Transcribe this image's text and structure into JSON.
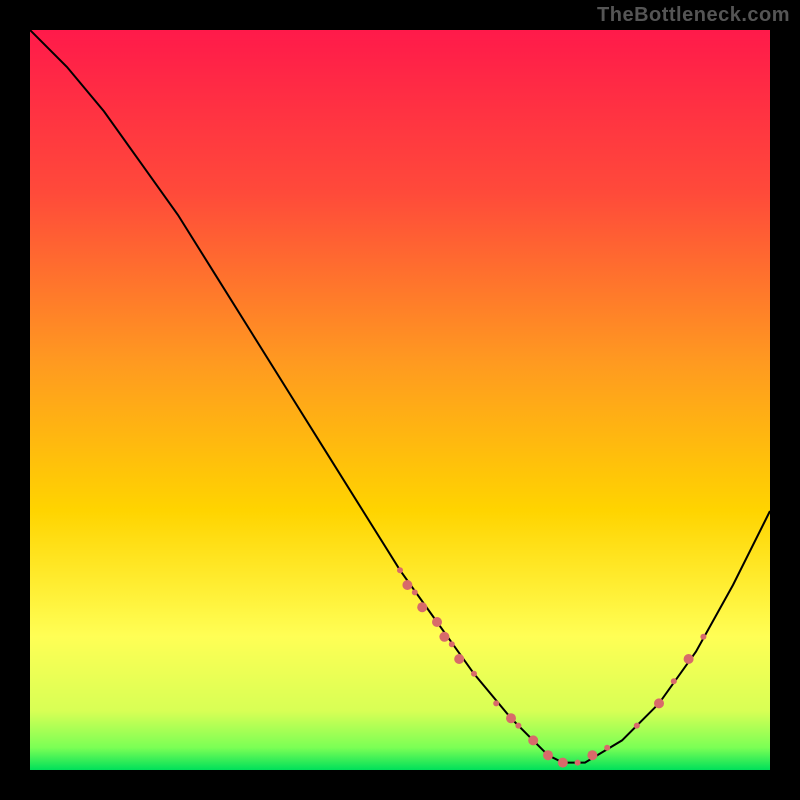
{
  "watermark": "TheBottleneck.com",
  "chart_data": {
    "type": "line",
    "title": "",
    "xlabel": "",
    "ylabel": "",
    "xlim": [
      0,
      100
    ],
    "ylim": [
      0,
      100
    ],
    "grid": false,
    "legend": false,
    "background_gradient": {
      "top": "#ff1a4a",
      "mid_upper": "#ff6a2a",
      "mid": "#ffd400",
      "mid_lower": "#ffff55",
      "bottom": "#00e05a"
    },
    "series": [
      {
        "name": "curve",
        "type": "line",
        "color": "#000000",
        "x": [
          0,
          5,
          10,
          15,
          20,
          25,
          30,
          35,
          40,
          45,
          50,
          55,
          60,
          65,
          68,
          70,
          72,
          75,
          80,
          85,
          90,
          95,
          100
        ],
        "y": [
          100,
          95,
          89,
          82,
          75,
          67,
          59,
          51,
          43,
          35,
          27,
          20,
          13,
          7,
          4,
          2,
          1,
          1,
          4,
          9,
          16,
          25,
          35
        ]
      },
      {
        "name": "dots-falling",
        "type": "scatter",
        "color": "#d86a6a",
        "radius_small": 3,
        "radius_large": 5,
        "points": [
          {
            "x": 50,
            "y": 27,
            "r": 3
          },
          {
            "x": 51,
            "y": 25,
            "r": 5
          },
          {
            "x": 52,
            "y": 24,
            "r": 3
          },
          {
            "x": 53,
            "y": 22,
            "r": 5
          },
          {
            "x": 55,
            "y": 20,
            "r": 5
          },
          {
            "x": 56,
            "y": 18,
            "r": 5
          },
          {
            "x": 57,
            "y": 17,
            "r": 3
          },
          {
            "x": 58,
            "y": 15,
            "r": 5
          },
          {
            "x": 60,
            "y": 13,
            "r": 3
          }
        ]
      },
      {
        "name": "dots-bottom",
        "type": "scatter",
        "color": "#d86a6a",
        "points": [
          {
            "x": 63,
            "y": 9,
            "r": 3
          },
          {
            "x": 65,
            "y": 7,
            "r": 5
          },
          {
            "x": 66,
            "y": 6,
            "r": 3
          },
          {
            "x": 68,
            "y": 4,
            "r": 5
          },
          {
            "x": 70,
            "y": 2,
            "r": 5
          },
          {
            "x": 72,
            "y": 1,
            "r": 5
          },
          {
            "x": 74,
            "y": 1,
            "r": 3
          },
          {
            "x": 76,
            "y": 2,
            "r": 5
          },
          {
            "x": 78,
            "y": 3,
            "r": 3
          }
        ]
      },
      {
        "name": "dots-rising",
        "type": "scatter",
        "color": "#d86a6a",
        "points": [
          {
            "x": 82,
            "y": 6,
            "r": 3
          },
          {
            "x": 85,
            "y": 9,
            "r": 5
          },
          {
            "x": 87,
            "y": 12,
            "r": 3
          },
          {
            "x": 89,
            "y": 15,
            "r": 5
          },
          {
            "x": 91,
            "y": 18,
            "r": 3
          }
        ]
      }
    ]
  }
}
